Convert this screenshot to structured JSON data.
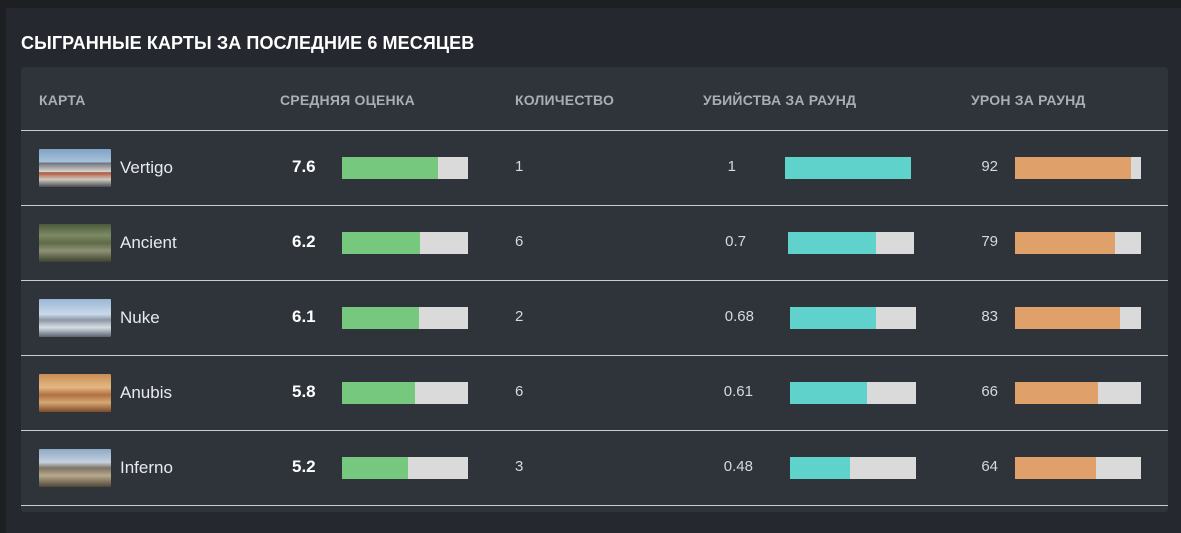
{
  "title": "СЫГРАННЫЕ КАРТЫ ЗА ПОСЛЕДНИЕ 6 МЕСЯЦЕВ",
  "columns": {
    "map": "КАРТА",
    "rating": "СРЕДНЯЯ ОЦЕНКА",
    "count": "КОЛИЧЕСТВО",
    "kills": "УБИЙСТВА ЗА РАУНД",
    "damage": "УРОН ЗА РАУНД"
  },
  "colors": {
    "rating": "#76c87e",
    "kills": "#5fd2cb",
    "damage": "#dfa06a",
    "track": "#dadada"
  },
  "rows": [
    {
      "map": "Vertigo",
      "thumb_icon": "vertigo-map-thumbnail",
      "rating": "7.6",
      "rating_fill": 0.76,
      "count": "1",
      "kills": "1",
      "kills_fill": 1.0,
      "damage": "92",
      "damage_fill": 0.92
    },
    {
      "map": "Ancient",
      "thumb_icon": "ancient-map-thumbnail",
      "rating": "6.2",
      "rating_fill": 0.62,
      "count": "6",
      "kills": "0.7",
      "kills_fill": 0.7,
      "damage": "79",
      "damage_fill": 0.79
    },
    {
      "map": "Nuke",
      "thumb_icon": "nuke-map-thumbnail",
      "rating": "6.1",
      "rating_fill": 0.61,
      "count": "2",
      "kills": "0.68",
      "kills_fill": 0.68,
      "damage": "83",
      "damage_fill": 0.83
    },
    {
      "map": "Anubis",
      "thumb_icon": "anubis-map-thumbnail",
      "rating": "5.8",
      "rating_fill": 0.58,
      "count": "6",
      "kills": "0.61",
      "kills_fill": 0.61,
      "damage": "66",
      "damage_fill": 0.66
    },
    {
      "map": "Inferno",
      "thumb_icon": "inferno-map-thumbnail",
      "rating": "5.2",
      "rating_fill": 0.52,
      "count": "3",
      "kills": "0.48",
      "kills_fill": 0.48,
      "damage": "64",
      "damage_fill": 0.64
    }
  ]
}
